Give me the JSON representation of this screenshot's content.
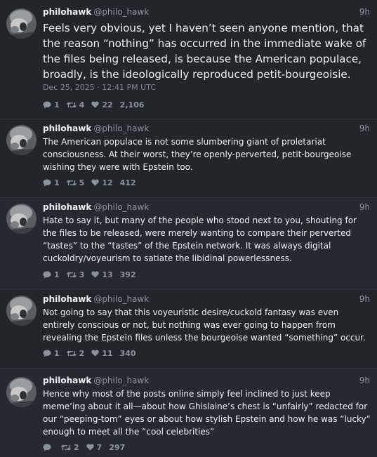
{
  "posts": [
    {
      "display_name": "philohawk",
      "handle": "@philo_hawk",
      "time": "9h",
      "text": "Feels very obvious, yet I haven’t seen anyone mention, that the reason “nothing” has occurred in the immediate wake of the files being released, is because the American populace, broadly, is the ideologically reproduced petit-bourgeoisie.",
      "date": "Dec 25, 2025 · 12:41 PM UTC",
      "replies": "1",
      "reposts": "4",
      "likes": "22",
      "views": "2,106"
    },
    {
      "display_name": "philohawk",
      "handle": "@philo_hawk",
      "time": "9h",
      "text": "The American populace is not some slumbering giant of proletariat consciousness. At their worst, they’re openly-perverted, petit-bourgeoise wishing they were with Epstein too.",
      "replies": "1",
      "reposts": "5",
      "likes": "12",
      "views": "412"
    },
    {
      "display_name": "philohawk",
      "handle": "@philo_hawk",
      "time": "9h",
      "text": "Hate to say it, but many of the people who stood next to you, shouting for the files to be released, were merely wanting to compare their perverted “tastes” to the “tastes” of the Epstein network. It was always digital cuckoldry/voyeurism to satiate the libidinal powerlessness.",
      "replies": "1",
      "reposts": "3",
      "likes": "13",
      "views": "392"
    },
    {
      "display_name": "philohawk",
      "handle": "@philo_hawk",
      "time": "9h",
      "text": "Not going to say that this voyeuristic desire/cuckold fantasy was even entirely conscious or not, but nothing was ever going to happen from revealing the Epstein files unless the bourgeoise wanted “something” occur.",
      "replies": "1",
      "reposts": "2",
      "likes": "11",
      "views": "340"
    },
    {
      "display_name": "philohawk",
      "handle": "@philo_hawk",
      "time": "9h",
      "text": "Hence why most of the posts online simply feel inclined to just keep meme’ing about it all—about how Ghislaine’s chest is “unfairly” redacted for our “peeping-tom” eyes or about how stylish Epstein and how he was “lucky” enough to meet all the “cool celebrities”",
      "replies": "",
      "reposts": "2",
      "likes": "7",
      "views": "297"
    }
  ],
  "icons": {
    "reply": "speech-bubble",
    "repost": "retweet-arrows",
    "like": "heart"
  },
  "colors": {
    "background": "#1e2227",
    "text": "#eef1f4",
    "muted": "#8a939c"
  }
}
